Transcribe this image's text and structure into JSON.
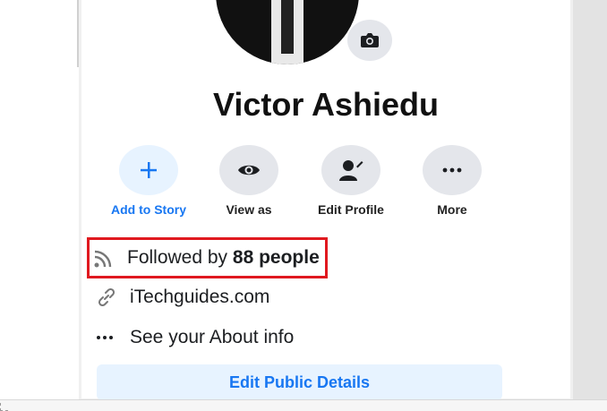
{
  "profile": {
    "name": "Victor Ashiedu"
  },
  "actions": [
    {
      "label": "Add to Story",
      "icon": "plus-icon"
    },
    {
      "label": "View as",
      "icon": "eye-icon"
    },
    {
      "label": "Edit Profile",
      "icon": "edit-profile-icon"
    },
    {
      "label": "More",
      "icon": "more-dots-icon"
    }
  ],
  "info": {
    "followed_prefix": "Followed by ",
    "followed_count": "88 people",
    "website": "iTechguides.com",
    "about": "See your About info"
  },
  "edit_public_details": "Edit Public Details",
  "colors": {
    "accent": "#1877f2",
    "highlight_border": "#e0191f",
    "button_gray": "#e4e6eb",
    "button_blue_bg": "#e7f3ff"
  }
}
